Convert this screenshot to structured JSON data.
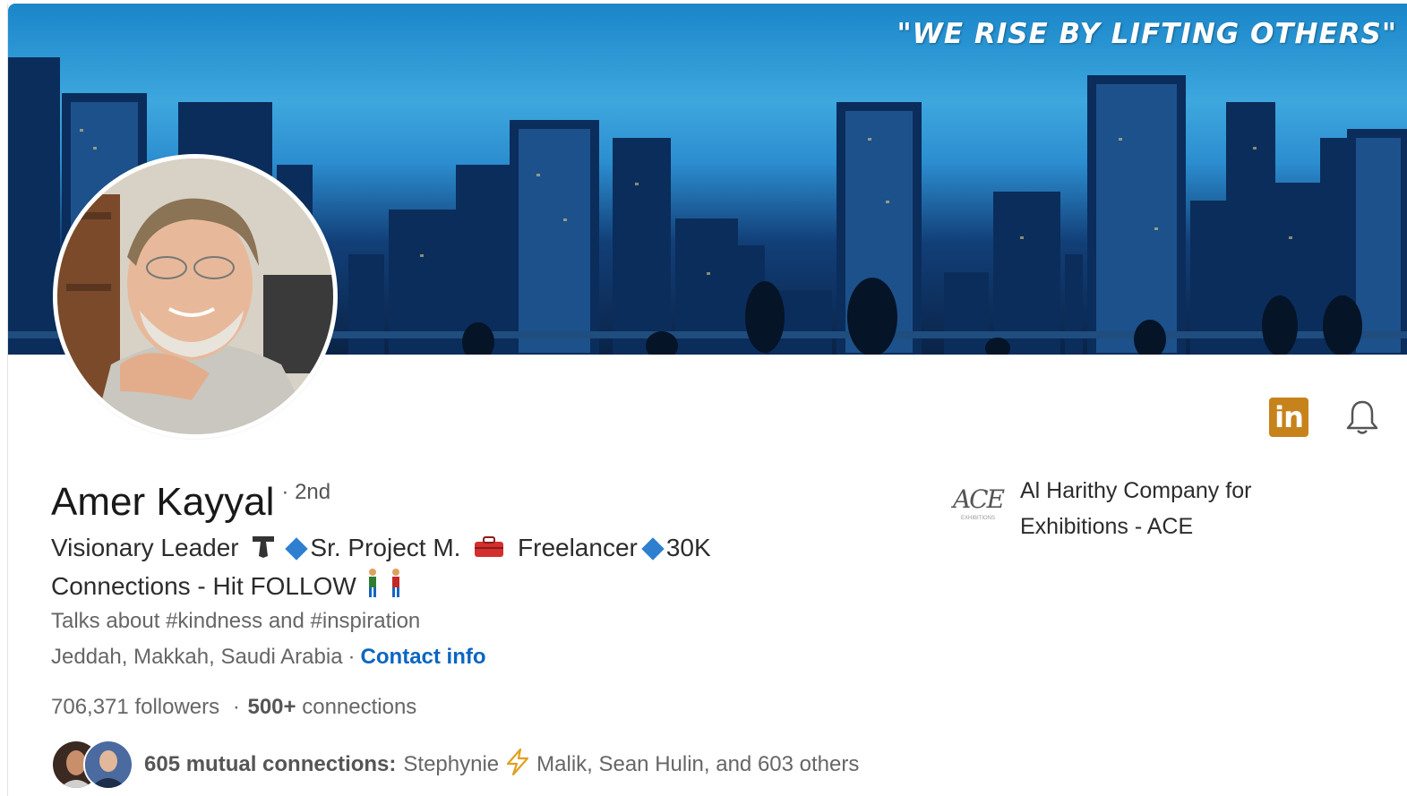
{
  "banner": {
    "quote": "\"WE RISE BY LIFTING OTHERS\""
  },
  "profile": {
    "name": "Amer Kayyal",
    "degree": "· 2nd",
    "headline_part1": "Visionary Leader",
    "headline_part2": "Sr. Project M.",
    "headline_part3": "Freelancer",
    "headline_part4": "30K",
    "headline_line2": "Connections - Hit FOLLOW",
    "talks_about": "Talks about #kindness and #inspiration",
    "location": "Jeddah, Makkah, Saudi Arabia",
    "location_sep": "·",
    "contact_info_label": "Contact info",
    "followers_count": "706,371",
    "followers_label": "followers",
    "connections_sep": "·",
    "connections_count": "500+",
    "connections_label": "connections",
    "mutual_label": "605 mutual connections:",
    "mutual_name1": "Stephynie",
    "mutual_rest": "Malik, Sean Hulin, and 603 others"
  },
  "company": {
    "name": "Al Harithy Company for Exhibitions - ACE",
    "logo_text": "ACE",
    "logo_subtext": "EXHIBITIONS"
  },
  "icons": {
    "linkedin": "linkedin-icon",
    "bell": "bell-icon",
    "bolt": "lightning-icon"
  },
  "colors": {
    "accent": "#0a66c2",
    "linkedin_badge": "#c7831b",
    "diamond": "#2f7fd1"
  }
}
